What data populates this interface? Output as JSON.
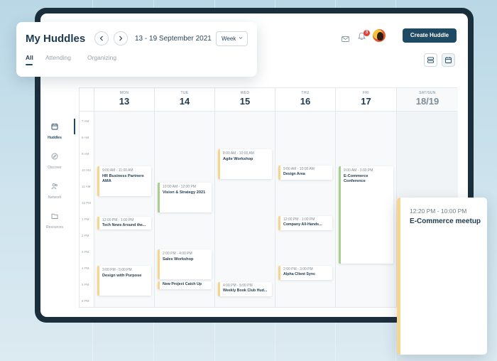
{
  "header": {
    "title": "My Huddles",
    "date_range": "13 - 19 September 2021",
    "view_select": "Week",
    "tabs": [
      {
        "label": "All",
        "active": true
      },
      {
        "label": "Attending",
        "active": false
      },
      {
        "label": "Organizing",
        "active": false
      }
    ]
  },
  "topbar": {
    "notification_count": "3",
    "create_button": "Create Huddle"
  },
  "sidebar": {
    "items": [
      {
        "label": "Huddles",
        "icon": "calendar-icon",
        "active": true
      },
      {
        "label": "Discover",
        "icon": "compass-icon",
        "active": false
      },
      {
        "label": "Network",
        "icon": "people-icon",
        "active": false
      },
      {
        "label": "Resources",
        "icon": "folder-icon",
        "active": false
      }
    ]
  },
  "calendar": {
    "days": [
      {
        "name": "MON",
        "num": "13"
      },
      {
        "name": "TUE",
        "num": "14"
      },
      {
        "name": "WED",
        "num": "15"
      },
      {
        "name": "THU",
        "num": "16"
      },
      {
        "name": "FRI",
        "num": "17"
      },
      {
        "name": "SAT/SUN",
        "num": "18/19"
      }
    ],
    "hours": [
      "7 AM",
      "8 AM",
      "9 AM",
      "10 AM",
      "11 AM",
      "12 PM",
      "1 PM",
      "2 PM",
      "3 PM",
      "4 PM",
      "5 PM",
      "6 PM"
    ],
    "events": [
      {
        "time": "9:00 AM - 11:00 AM",
        "title": "HR Business Partners AMA",
        "day": 0
      },
      {
        "time": "12:00 PM - 1:00 PM",
        "title": "Tech News Around the...",
        "day": 0
      },
      {
        "time": "3:00 PM - 5:00 PM",
        "title": "Design with Purpose",
        "day": 0
      },
      {
        "time": "10:00 AM - 12:00 PM",
        "title": "Vision & Strategy 2021",
        "day": 1
      },
      {
        "time": "2:00 PM - 4:00 PM",
        "title": "Sales Workshop",
        "day": 1
      },
      {
        "time": "",
        "title": "New Project Catch Up",
        "day": 1
      },
      {
        "time": "8:00 AM - 10:00 AM",
        "title": "Agile Workshop",
        "day": 2
      },
      {
        "time": "4:00 PM - 5:00 PM",
        "title": "Weekly Book Club Hud...",
        "day": 2
      },
      {
        "time": "9:00 AM - 10:00 AM",
        "title": "Design Area",
        "day": 3
      },
      {
        "time": "12:00 PM - 1:00 PM",
        "title": "Company All-Hands...",
        "day": 3
      },
      {
        "time": "2:00 PM - 3:00 PM",
        "title": "Alpha Client Sync",
        "day": 3
      },
      {
        "time": "9:00 AM - 3:00 PM",
        "title": "E-Commerce Conference",
        "day": 4
      }
    ]
  },
  "detail": {
    "time": "12:20 PM - 10:00 PM",
    "title": "E-Commerce meetup"
  },
  "colors": {
    "primary": "#1e4a63",
    "frame": "#1b2e3b",
    "accent_yellow": "#f6d58c",
    "accent_green": "#a8cf8e",
    "badge": "#e0423d"
  }
}
